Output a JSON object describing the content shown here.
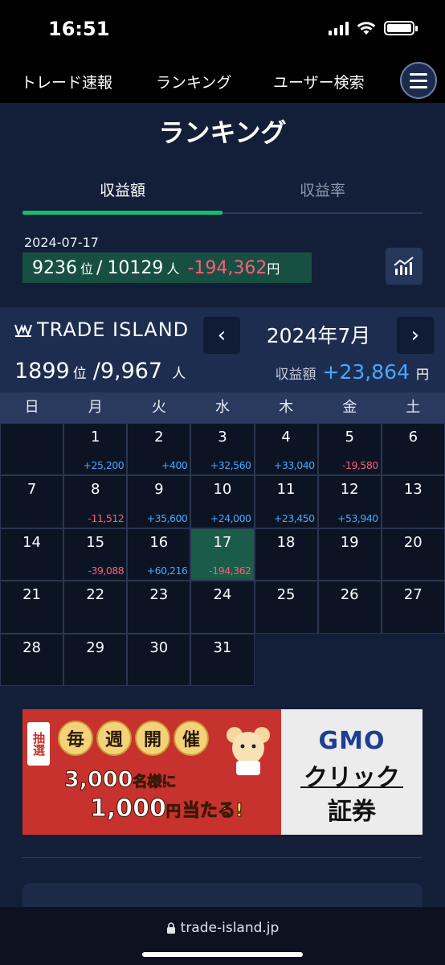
{
  "status_bar": {
    "time": "16:51"
  },
  "nav": {
    "items": [
      "トレード速報",
      "ランキング",
      "ユーザー検索"
    ]
  },
  "page": {
    "title": "ランキング"
  },
  "tabs": [
    {
      "label": "収益額",
      "active": true
    },
    {
      "label": "収益率",
      "active": false
    }
  ],
  "daily_stats": {
    "date": "2024-07-17",
    "rank": "9236",
    "rank_unit": "位",
    "separator": "/",
    "total": "10129",
    "total_unit": "人",
    "profit": "-194,362",
    "yen": "円"
  },
  "trade_island": {
    "logo_text": "TRADE ISLAND",
    "month": "2024年7月",
    "prev": "‹",
    "next": "›",
    "rank": "1899",
    "rank_unit": "位",
    "total": "/9,967",
    "total_unit": "人",
    "profit_label": "収益額",
    "profit": "+23,864",
    "yen": "円"
  },
  "calendar": {
    "weekdays": [
      "日",
      "月",
      "火",
      "水",
      "木",
      "金",
      "土"
    ],
    "weeks": [
      [
        null,
        {
          "day": "1",
          "amt": "+25,200",
          "sign": "pos"
        },
        {
          "day": "2",
          "amt": "+400",
          "sign": "pos"
        },
        {
          "day": "3",
          "amt": "+32,560",
          "sign": "pos"
        },
        {
          "day": "4",
          "amt": "+33,040",
          "sign": "pos"
        },
        {
          "day": "5",
          "amt": "-19,580",
          "sign": "neg"
        },
        {
          "day": "6"
        }
      ],
      [
        {
          "day": "7"
        },
        {
          "day": "8",
          "amt": "-11,512",
          "sign": "neg"
        },
        {
          "day": "9",
          "amt": "+35,600",
          "sign": "pos"
        },
        {
          "day": "10",
          "amt": "+24,000",
          "sign": "pos"
        },
        {
          "day": "11",
          "amt": "+23,450",
          "sign": "pos"
        },
        {
          "day": "12",
          "amt": "+53,940",
          "sign": "pos"
        },
        {
          "day": "13"
        }
      ],
      [
        {
          "day": "14"
        },
        {
          "day": "15",
          "amt": "-39,088",
          "sign": "neg"
        },
        {
          "day": "16",
          "amt": "+60,216",
          "sign": "pos"
        },
        {
          "day": "17",
          "amt": "-194,362",
          "sign": "neg",
          "today": true
        },
        {
          "day": "18"
        },
        {
          "day": "19"
        },
        {
          "day": "20"
        }
      ],
      [
        {
          "day": "21"
        },
        {
          "day": "22"
        },
        {
          "day": "23"
        },
        {
          "day": "24"
        },
        {
          "day": "25"
        },
        {
          "day": "26"
        },
        {
          "day": "27"
        }
      ],
      [
        {
          "day": "28"
        },
        {
          "day": "29"
        },
        {
          "day": "30"
        },
        {
          "day": "31"
        },
        "blank",
        "blank",
        "blank"
      ]
    ]
  },
  "banner": {
    "tag": "抽選",
    "coins": [
      "毎",
      "週",
      "開",
      "催"
    ],
    "line1_num": "3,000",
    "line1_text": "名様に",
    "line2_num": "1,000",
    "line2_unit": "円",
    "line2_hit": "当たる!",
    "brand": "GMO",
    "brand2": "クリック",
    "brand3": "証券"
  },
  "browser": {
    "url": "trade-island.jp"
  },
  "colors": {
    "accent": "#12c06b",
    "positive": "#48a7ff",
    "negative": "#ff5c7a"
  }
}
